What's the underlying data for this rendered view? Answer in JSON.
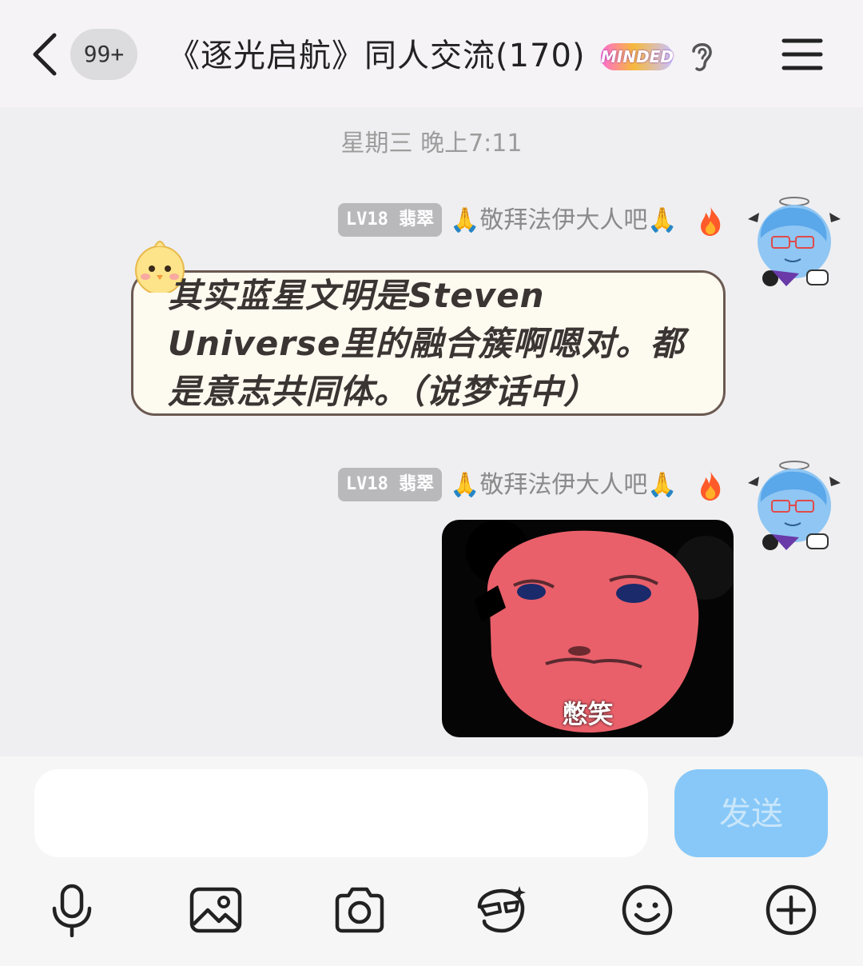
{
  "header": {
    "unread_count": "99+",
    "title": "《逐光启航》同人交流(170)",
    "brand_logo": "MINDED"
  },
  "timestamp": "星期三 晚上7:11",
  "messages": [
    {
      "level": "LV18 翡翠",
      "nickname": "🙏敬拜法伊大人吧🙏",
      "text": "其实蓝星文明是Steven Universe里的融合簇啊嗯对。都是意志共同体。（说梦话中）"
    },
    {
      "level": "LV18 翡翠",
      "nickname": "🙏敬拜法伊大人吧🙏",
      "sticker_caption": "憋笑"
    }
  ],
  "composer": {
    "input_value": "",
    "send_label": "发送"
  },
  "toolbar": [
    "microphone-icon",
    "image-icon",
    "camera-icon",
    "mask-icon",
    "emoji-icon",
    "plus-icon"
  ],
  "colors": {
    "header_bg": "#f5f3f6",
    "chat_bg": "#efeff1",
    "send_button": "#87c8f8",
    "level_badge": "#b9b9bc",
    "bubble_bg": "#fdfaf0"
  }
}
